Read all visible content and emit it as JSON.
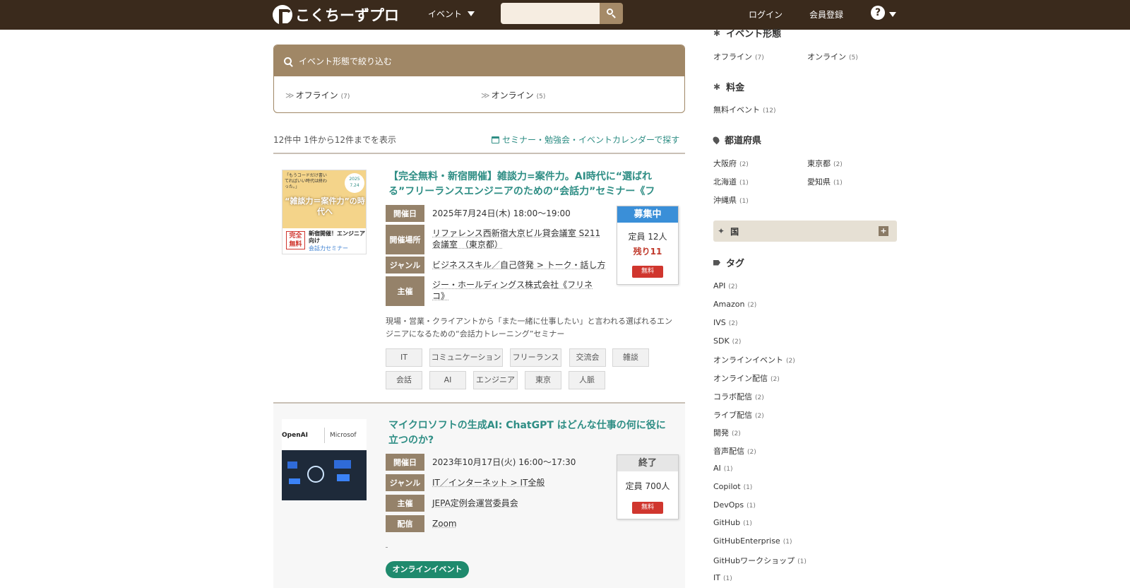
{
  "header": {
    "logo_text": "こくちーずプロ",
    "nav_event": "イベント",
    "search_placeholder": "",
    "login": "ログイン",
    "register": "会員登録",
    "help": "?"
  },
  "filter": {
    "title": "イベント形態で絞り込む",
    "options": [
      {
        "label": "オフライン",
        "count": "(7)"
      },
      {
        "label": "オンライン",
        "count": "(5)"
      }
    ]
  },
  "results": {
    "summary": "12件中 1件から12件までを表示",
    "calendar_link": "セミナー・勉強会・イベントカレンダーで探す"
  },
  "events": [
    {
      "title_line1": "【完全無料・新宿開催】雑談力=案件力。AI時代に“選ばれ",
      "title_line2": "る”フリーランスエンジニアのための“会話力”セミナー《フ",
      "thumb": {
        "top_text": "「もうコードだけ書いてればいい時代は終わった。」",
        "date": "2025 7.24",
        "headline": "“雑談力＝案件力”の時代へ",
        "badge": "完全無料",
        "sub": "新宿開催！エンジニア向け",
        "sub2": "会話力セミナー"
      },
      "rows": [
        {
          "label": "開催日",
          "value": "2025年7月24日(木) 18:00〜19:00"
        },
        {
          "label": "開催場所",
          "value": "リファレンス西新宿大京ビル貸会議室 S211 会議室 （東京都）"
        },
        {
          "label": "ジャンル",
          "value": "ビジネススキル／自己啓発 > トーク・話し方"
        },
        {
          "label": "主催",
          "value": "ジー・ホールディングス株式会社《フリネコ》"
        }
      ],
      "status": {
        "head": "募集中",
        "capacity": "定員 12人",
        "remaining": "残り11",
        "price": "無料"
      },
      "description": "現場・営業・クライアントから「また一緒に仕事したい」と言われる選ばれるエンジニアになるための“会話力トレーニング”セミナー",
      "tags": [
        "IT",
        "コミュニケーション",
        "フリーランス",
        "交流会",
        "雑談",
        "会話",
        "AI",
        "エンジニア",
        "東京",
        "人脈"
      ]
    },
    {
      "title_line1": "マイクロソフトの生成AI: ChatGPT はどんな仕事の何に役に",
      "title_line2": "立つのか?",
      "thumb": {
        "logo1": "OpenAI",
        "logo2": "Microsof"
      },
      "rows": [
        {
          "label": "開催日",
          "value": "2023年10月17日(火) 16:00〜17:30"
        },
        {
          "label": "ジャンル",
          "value": "IT／インターネット > IT全般"
        },
        {
          "label": "主催",
          "value": "JEPA定例会運営委員会"
        },
        {
          "label": "配信",
          "value": "Zoom"
        }
      ],
      "status": {
        "head": "終了",
        "capacity": "定員 700人",
        "price": "無料"
      },
      "online_badge": "オンラインイベント"
    }
  ],
  "sidebar": {
    "format": {
      "title": "イベント形態",
      "items": [
        {
          "label": "オフライン",
          "count": "(7)"
        },
        {
          "label": "オンライン",
          "count": "(5)"
        }
      ]
    },
    "price": {
      "title": "料金",
      "items": [
        {
          "label": "無料イベント",
          "count": "(12)"
        }
      ]
    },
    "prefecture": {
      "title": "都道府県",
      "items": [
        {
          "label": "大阪府",
          "count": "(2)"
        },
        {
          "label": "東京都",
          "count": "(2)"
        },
        {
          "label": "北海道",
          "count": "(1)"
        },
        {
          "label": "愛知県",
          "count": "(1)"
        },
        {
          "label": "沖縄県",
          "count": "(1)"
        }
      ]
    },
    "country": {
      "title": "国",
      "expand": "+"
    },
    "tags": {
      "title": "タグ",
      "items": [
        {
          "label": "API",
          "count": "(2)"
        },
        {
          "label": "Amazon",
          "count": "(2)"
        },
        {
          "label": "IVS",
          "count": "(2)"
        },
        {
          "label": "SDK",
          "count": "(2)"
        },
        {
          "label": "オンラインイベント",
          "count": "(2)"
        },
        {
          "label": "オンライン配信",
          "count": "(2)"
        },
        {
          "label": "コラボ配信",
          "count": "(2)"
        },
        {
          "label": "ライブ配信",
          "count": "(2)"
        },
        {
          "label": "開発",
          "count": "(2)"
        },
        {
          "label": "音声配信",
          "count": "(2)"
        },
        {
          "label": "AI",
          "count": "(1)"
        },
        {
          "label": "Copilot",
          "count": "(1)"
        },
        {
          "label": "DevOps",
          "count": "(1)"
        },
        {
          "label": "GitHub",
          "count": "(1)"
        },
        {
          "label": "GitHubEnterprise",
          "count": "(1)"
        },
        {
          "label": "GitHubワークショップ",
          "count": "(1)"
        },
        {
          "label": "IT",
          "count": "(1)"
        }
      ]
    }
  }
}
